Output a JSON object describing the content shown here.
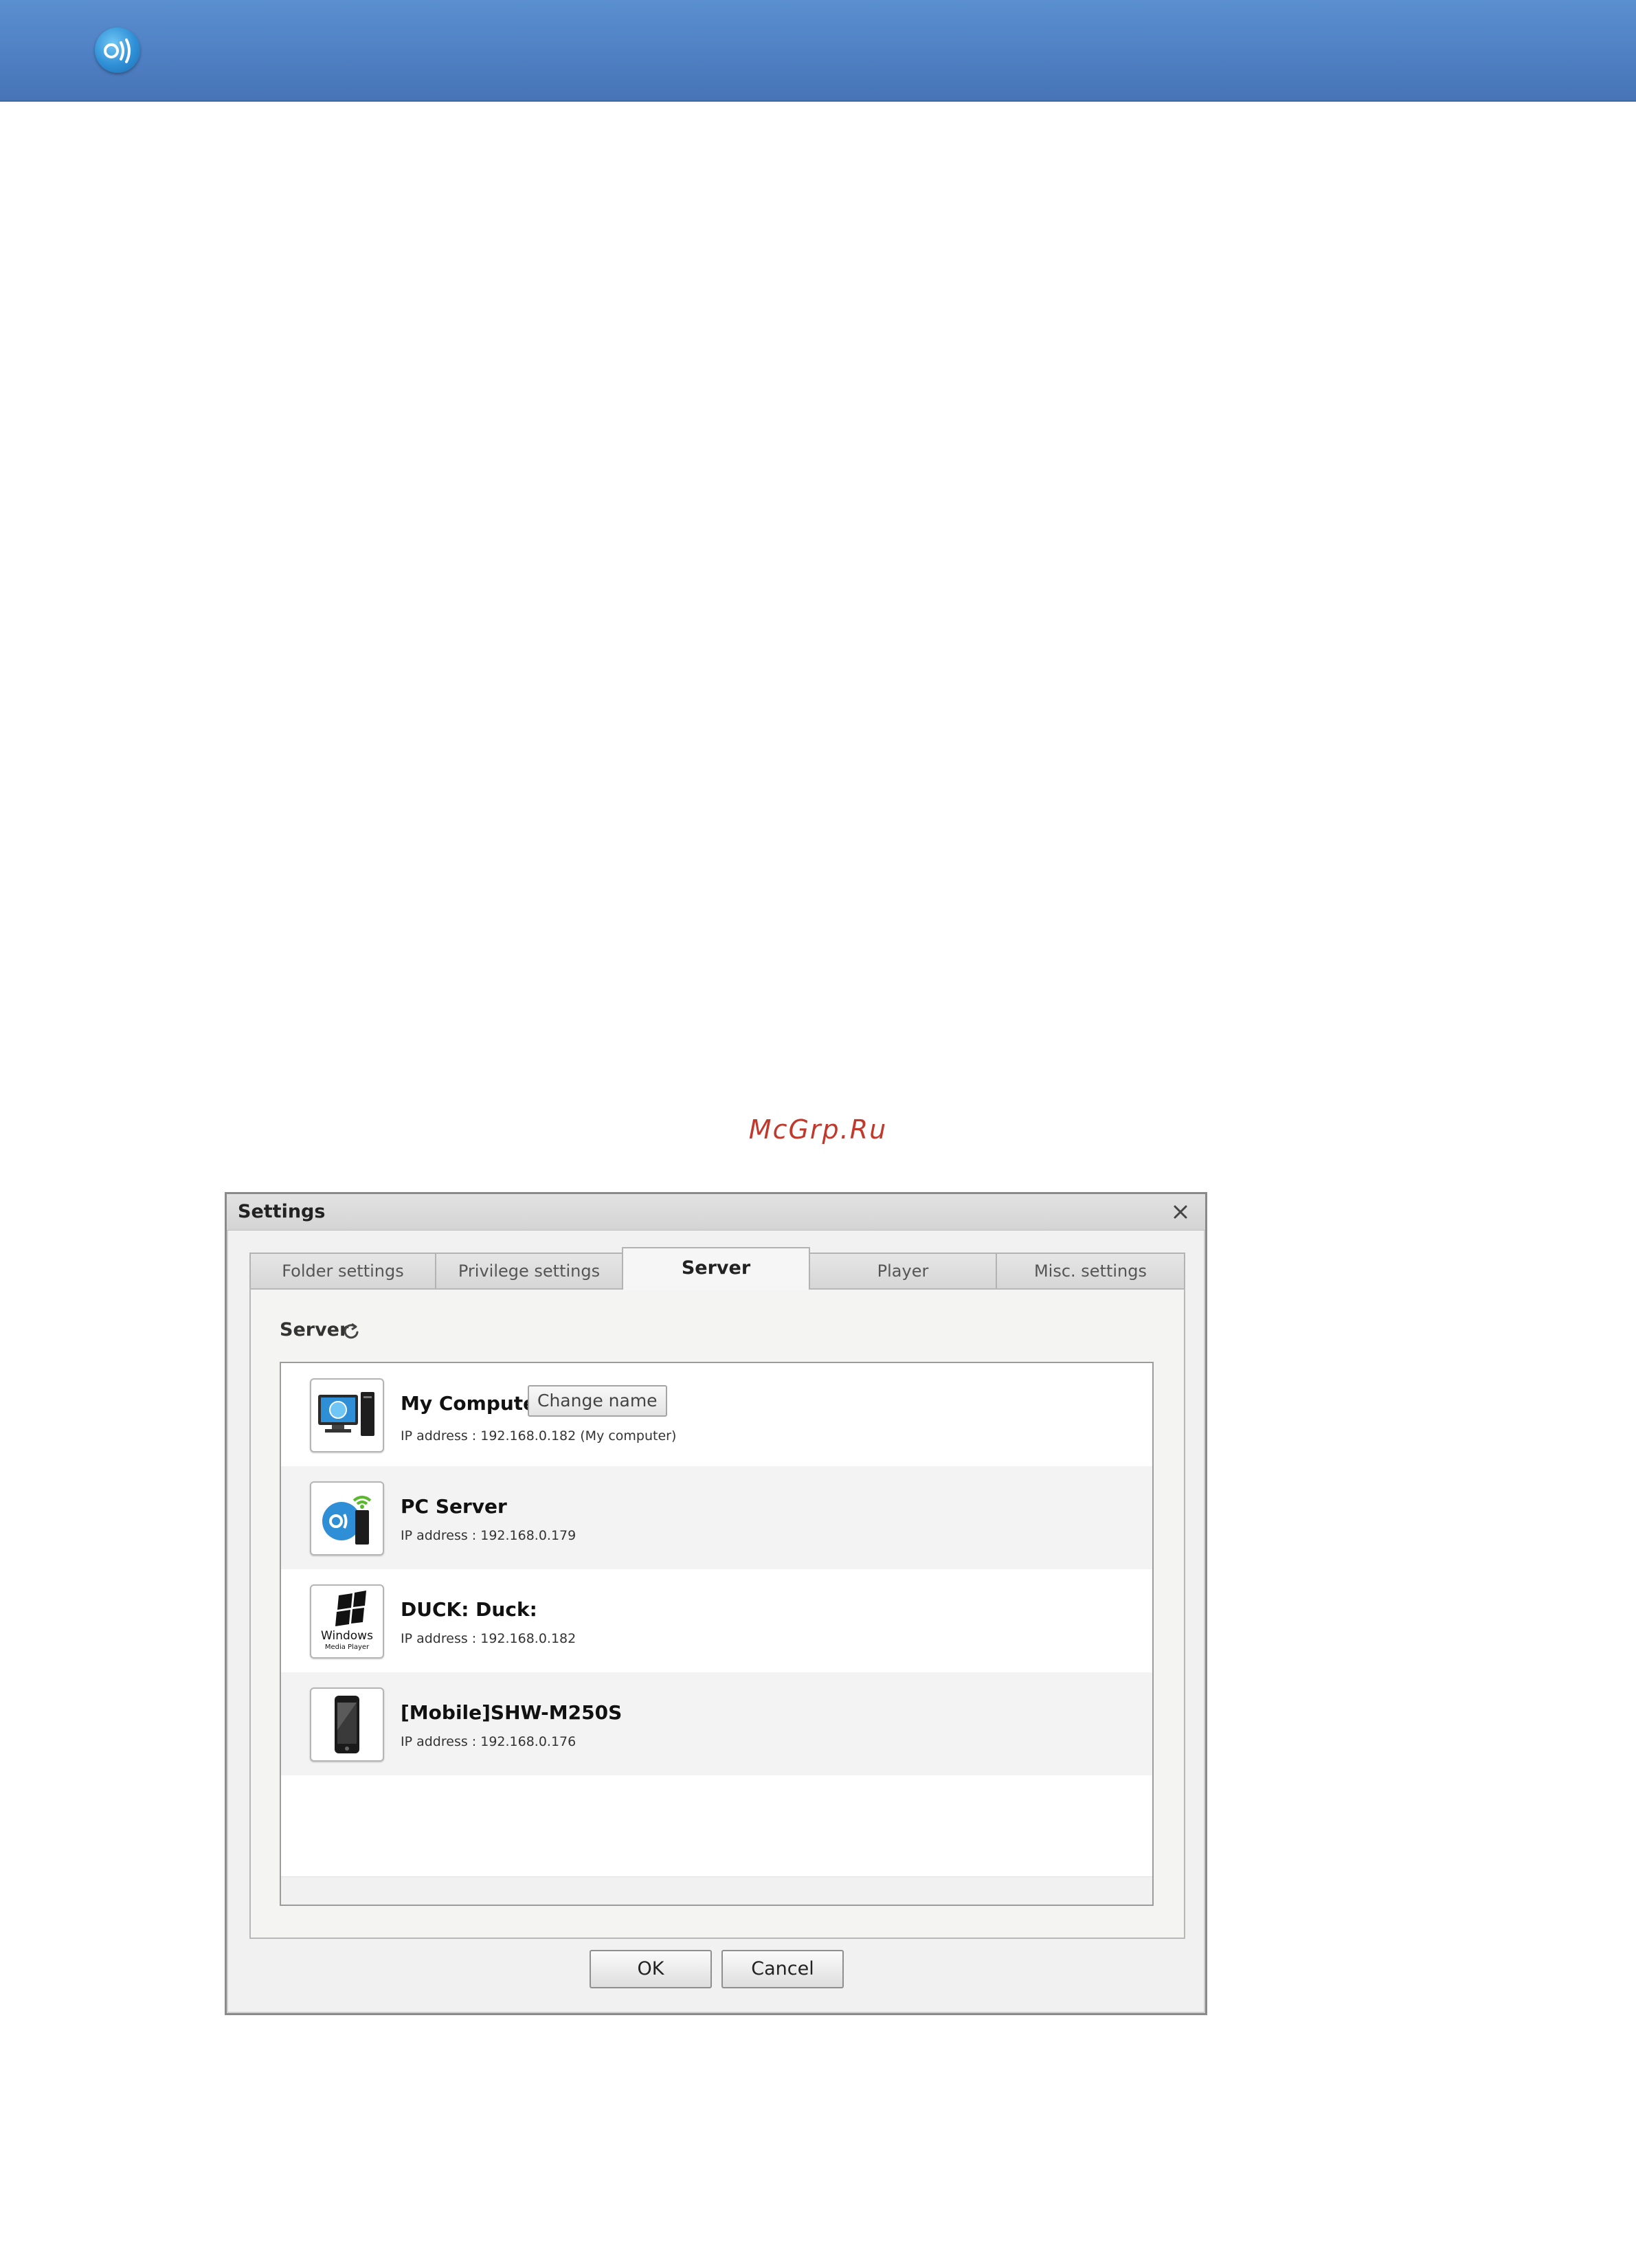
{
  "banner": {
    "logo_icon": "allshare-logo-icon"
  },
  "watermark": "McGrp.Ru",
  "dialog": {
    "title": "Settings",
    "close_icon": "close-icon",
    "tabs": [
      {
        "label": "Folder settings",
        "active": false
      },
      {
        "label": "Privilege settings",
        "active": false
      },
      {
        "label": "Server",
        "active": true
      },
      {
        "label": "Player",
        "active": false
      },
      {
        "label": "Misc. settings",
        "active": false
      }
    ],
    "section_label": "Server",
    "refresh_icon": "refresh-icon",
    "servers": [
      {
        "name": "My Computer",
        "ip": "IP address : 192.168.0.182 (My computer)",
        "icon": "computer-icon",
        "button": "Change name"
      },
      {
        "name": "PC Server",
        "ip": "IP address : 192.168.0.179",
        "icon": "pc-server-icon"
      },
      {
        "name": "DUCK: Duck:",
        "ip": "IP address : 192.168.0.182",
        "icon": "windows-media-player-icon",
        "icon_text_1": "Windows",
        "icon_text_2": "Media Player"
      },
      {
        "name": "[Mobile]SHW-M250S",
        "ip": "IP address : 192.168.0.176",
        "icon": "mobile-phone-icon"
      }
    ],
    "ok_label": "OK",
    "cancel_label": "Cancel"
  }
}
